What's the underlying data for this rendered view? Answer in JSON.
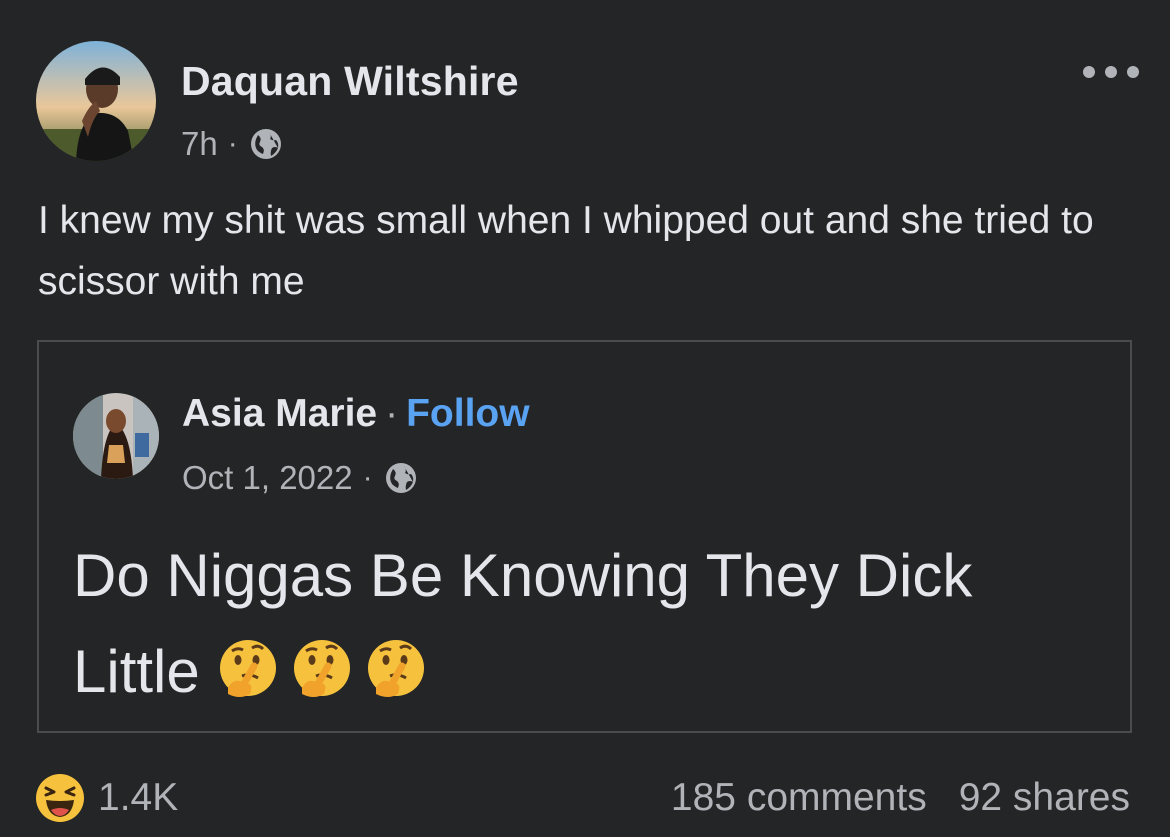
{
  "post": {
    "author": "Daquan Wiltshire",
    "time": "7h",
    "separator": "·",
    "privacy_icon": "globe-icon",
    "text": "I knew my shit was small when I whipped out and she tried to scissor with me",
    "more_icon": "more-options-icon"
  },
  "shared_post": {
    "author": "Asia Marie",
    "separator": "·",
    "follow_label": "Follow",
    "date": "Oct 1, 2022",
    "privacy_icon": "globe-icon",
    "text": "Do Niggas Be Knowing They Dick Little",
    "emojis": [
      "thinking-face-emoji",
      "thinking-face-emoji",
      "thinking-face-emoji"
    ]
  },
  "footer": {
    "reaction_icon": "laughing-haha-emoji",
    "reaction_count": "1.4K",
    "comments": "185 comments",
    "shares": "92 shares"
  },
  "colors": {
    "background": "#242526",
    "text_primary": "#e4e6eb",
    "text_secondary": "#b0b3b8",
    "link": "#5aa2f2",
    "border": "#4b4c4f"
  }
}
